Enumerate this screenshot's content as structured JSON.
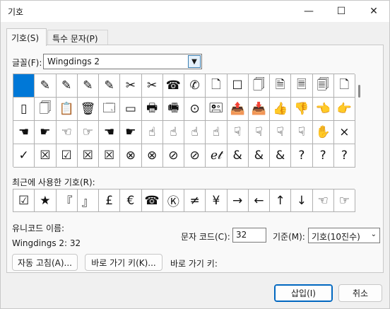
{
  "window": {
    "title": "기호",
    "minimize_glyph": "—",
    "maximize_glyph": "☐",
    "close_glyph": "✕"
  },
  "tabs": [
    {
      "label": "기호(S)"
    },
    {
      "label": "특수 문자(P)"
    }
  ],
  "font": {
    "label": "글꼴(F):",
    "value": "Wingdings 2"
  },
  "symbol_grid": [
    [
      "",
      "✎",
      "✎",
      "✎",
      "✎",
      "✂",
      "✂",
      "☎",
      "✆",
      "🗋",
      "☐",
      "🗍",
      "🗎",
      "🗏",
      "🗐",
      "🗋"
    ],
    [
      "▯",
      "🗍",
      "📋",
      "🗑",
      "🗔",
      "▭",
      "🖶",
      "🖷",
      "⊙",
      "🖭",
      "📤",
      "📥",
      "👍",
      "👎",
      "👈",
      "👉"
    ],
    [
      "☚",
      "☛",
      "☜",
      "☞",
      "☚",
      "☛",
      "☝",
      "☝",
      "☝",
      "☝",
      "☟",
      "☟",
      "☟",
      "☟",
      "✋",
      "×"
    ],
    [
      "✓",
      "☒",
      "☑",
      "☒",
      "☒",
      "⊗",
      "⊗",
      "⊘",
      "⊘",
      "ℯ𝓉",
      "&",
      "&",
      "&",
      "?",
      "?",
      "?"
    ]
  ],
  "recent": {
    "label": "최근에 사용한 기호(R):",
    "symbols": [
      "☑",
      "★",
      "『",
      "』",
      "£",
      "€",
      "☎",
      "Ⓚ",
      "≠",
      "¥",
      "→",
      "←",
      "↑",
      "↓",
      "☜",
      "☞"
    ]
  },
  "unicode": {
    "name_label": "유니코드 이름:",
    "value": "Wingdings 2: 32"
  },
  "char_code": {
    "label": "문자 코드(C):",
    "value": "32"
  },
  "base": {
    "label": "기준(M):",
    "value": "기호(10진수)"
  },
  "buttons": {
    "autocorrect": "자동 고침(A)...",
    "shortcut_key": "바로 가기 키(K)...",
    "shortcut_label": "바로 가기 키:",
    "insert": "삽입(I)",
    "cancel": "취소"
  },
  "colors": {
    "selection": "#0078d7",
    "accent": "#0067c0"
  }
}
